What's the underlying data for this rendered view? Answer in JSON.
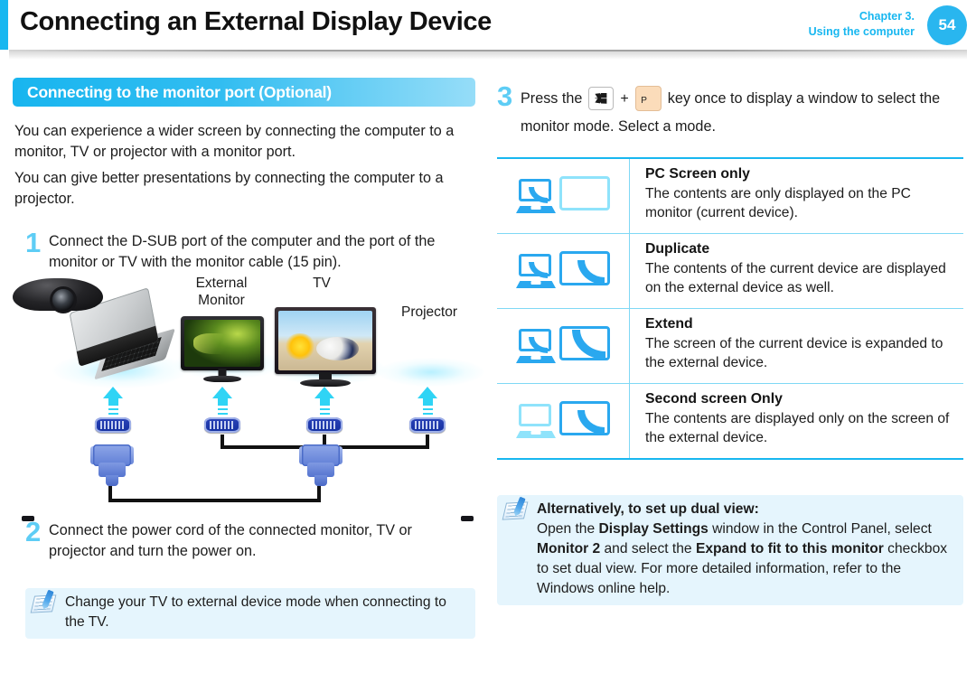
{
  "header": {
    "title": "Connecting an External Display Device",
    "chapter_line1": "Chapter 3.",
    "chapter_line2": "Using the computer",
    "page_number": "54",
    "accent_color": "#18b7f0"
  },
  "left": {
    "section_heading": "Connecting to the monitor port (Optional)",
    "paragraph_1": "You can experience a wider screen by connecting the computer to a monitor, TV or projector with a monitor port.",
    "paragraph_2": "You can give better presentations by connecting the computer to a projector.",
    "step_1": {
      "number": "1",
      "text": "Connect the D-SUB port of the computer and the port of the monitor or TV with the monitor cable (15 pin)."
    },
    "step_2": {
      "number": "2",
      "text": "Connect the power cord of the connected monitor, TV or projector and turn the power on."
    },
    "diagram": {
      "label_external_monitor_line1": "External",
      "label_external_monitor_line2": "Monitor",
      "label_tv": "TV",
      "label_projector": "Projector"
    },
    "note": {
      "text": "Change your TV to external device mode when connecting to the TV."
    }
  },
  "right": {
    "step_3": {
      "number": "3",
      "text_before_keys": "Press the",
      "key_windows": "windows-key-icon",
      "plus": "+",
      "key_p": "P",
      "text_after_keys": "key once to display a window to select",
      "text_line2": "the monitor mode. Select a mode."
    },
    "modes": [
      {
        "icon": "pc-screen-only-icon",
        "title": "PC Screen only",
        "description": "The contents are only displayed on the PC monitor (current device)."
      },
      {
        "icon": "duplicate-icon",
        "title": "Duplicate",
        "description": "The contents of the current device are displayed on the external device as well."
      },
      {
        "icon": "extend-icon",
        "title": "Extend",
        "description": "The screen of the current device is expanded to the external device."
      },
      {
        "icon": "second-screen-only-icon",
        "title": "Second screen Only",
        "description": "The contents are displayed only on the screen of the external device."
      }
    ],
    "note": {
      "title": "Alternatively, to set up dual view:",
      "body_part_1": "Open the ",
      "bold_1": "Display Settings",
      "body_part_2": " window in the Control Panel, select ",
      "bold_2": "Monitor 2",
      "body_part_3": " and select the ",
      "bold_3": "Expand to fit to this monitor",
      "body_part_4": " checkbox to set dual view. For more detailed information, refer to the Windows online help."
    }
  }
}
